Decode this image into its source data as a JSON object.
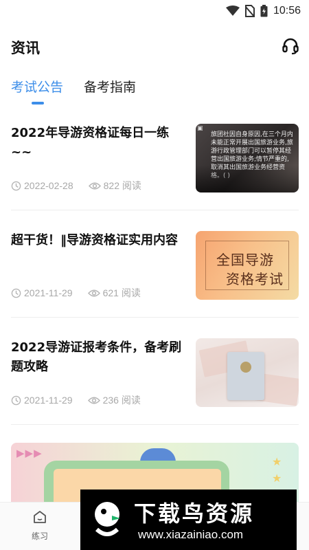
{
  "status_bar": {
    "time": "10:56"
  },
  "header": {
    "title": "资讯"
  },
  "tabs": [
    {
      "label": "考试公告",
      "active": true
    },
    {
      "label": "备考指南",
      "active": false
    }
  ],
  "articles": [
    {
      "title": "2022年导游资格证每日一练~~",
      "date": "2022-02-28",
      "views": "822 阅读",
      "thumb_text": "旅团社因自身原因,在三个月内未能正常开展出国旅游业务,旅游行政管理部门可以暂停其经营出国旅游业务;情节严重的,取消其出国旅游业务经营资格。(   )"
    },
    {
      "title": "超干货！‖导游资格证实用内容",
      "date": "2021-11-29",
      "views": "621 阅读",
      "thumb_lines": [
        "全国导游",
        "资格考试"
      ]
    },
    {
      "title": "2022导游证报考条件，备考刷题攻略",
      "date": "2021-11-29",
      "views": "236 阅读"
    }
  ],
  "bottom_nav": {
    "practice_label": "练习"
  },
  "watermark": {
    "title": "下载鸟资源",
    "url": "www.xiazainiao.com"
  },
  "colors": {
    "accent": "#3d8ee9",
    "meta": "#a8a8a8"
  }
}
